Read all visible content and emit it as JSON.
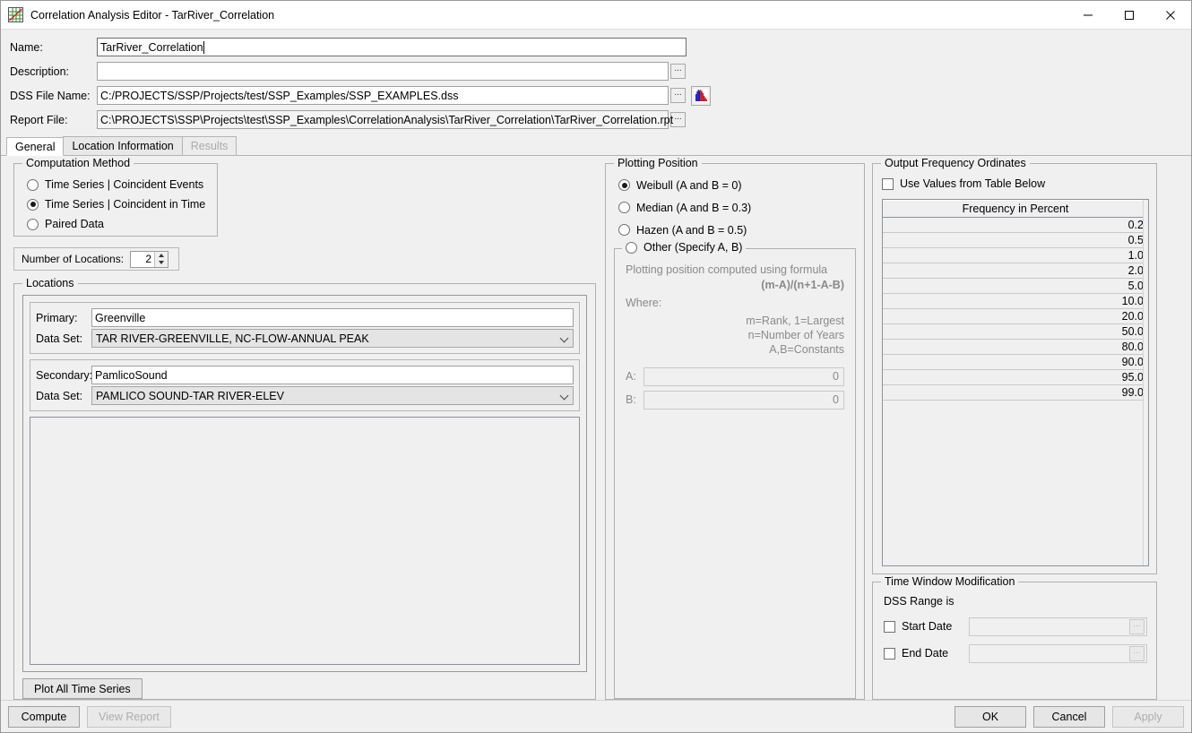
{
  "window": {
    "title": "Correlation Analysis Editor - TarRiver_Correlation",
    "app_icon": "correlation-plot-icon",
    "minimize_icon": "minimize-icon",
    "maximize_icon": "maximize-icon",
    "close_icon": "close-icon"
  },
  "form": {
    "name_label": "Name:",
    "name_value": "TarRiver_Correlation",
    "description_label": "Description:",
    "description_value": "",
    "dss_label": "DSS File Name:",
    "dss_value": "C:/PROJECTS/SSP/Projects/test/SSP_Examples/SSP_EXAMPLES.dss",
    "report_label": "Report File:",
    "report_value": "C:\\PROJECTS\\SSP\\Projects\\test\\SSP_Examples\\CorrelationAnalysis\\TarRiver_Correlation\\TarRiver_Correlation.rpt",
    "browse_label": "...",
    "dss_icon": "histogram-icon"
  },
  "tabs": [
    {
      "label": "General",
      "state": "active"
    },
    {
      "label": "Location Information",
      "state": "enabled"
    },
    {
      "label": "Results",
      "state": "disabled"
    }
  ],
  "computation_method": {
    "legend": "Computation Method",
    "options": [
      {
        "label": "Time Series | Coincident Events",
        "selected": false
      },
      {
        "label": "Time Series | Coincident in Time",
        "selected": true
      },
      {
        "label": "Paired Data",
        "selected": false
      }
    ]
  },
  "number_of_locations": {
    "label": "Number of Locations:",
    "value": "2"
  },
  "locations": {
    "legend": "Locations",
    "primary": {
      "label": "Primary:",
      "value": "Greenville",
      "dataset_label": "Data Set:",
      "dataset_value": "TAR RIVER-GREENVILLE, NC-FLOW-ANNUAL PEAK"
    },
    "secondary": {
      "label": "Secondary:",
      "value": "PamlicoSound",
      "dataset_label": "Data Set:",
      "dataset_value": "PAMLICO SOUND-TAR RIVER-ELEV"
    },
    "plot_button": "Plot All Time Series"
  },
  "plotting_position": {
    "legend": "Plotting Position",
    "options": [
      {
        "label": "Weibull (A and B = 0)",
        "selected": true
      },
      {
        "label": "Median (A and B = 0.3)",
        "selected": false
      },
      {
        "label": "Hazen (A and B = 0.5)",
        "selected": false
      }
    ],
    "other": {
      "label": "Other (Specify A, B)",
      "selected": false,
      "formula_intro": "Plotting position computed using formula",
      "formula": "(m-A)/(n+1-A-B)",
      "where_label": "Where:",
      "where_lines": [
        "m=Rank, 1=Largest",
        "n=Number of Years",
        "A,B=Constants"
      ],
      "a_label": "A:",
      "a_value": "0",
      "b_label": "B:",
      "b_value": "0"
    }
  },
  "output_frequency_ordinates": {
    "legend": "Output Frequency Ordinates",
    "use_values_label": "Use Values from Table Below",
    "use_values_checked": false,
    "column_header": "Frequency in Percent",
    "values": [
      "0.2",
      "0.5",
      "1.0",
      "2.0",
      "5.0",
      "10.0",
      "20.0",
      "50.0",
      "80.0",
      "90.0",
      "95.0",
      "99.0"
    ]
  },
  "time_window": {
    "legend": "Time Window Modification",
    "dss_range_label": "DSS Range is",
    "start_date_label": "Start Date",
    "start_date_checked": false,
    "start_date_value": "",
    "end_date_label": "End Date",
    "end_date_checked": false,
    "end_date_value": "",
    "browse_label": "..."
  },
  "footer": {
    "compute": "Compute",
    "view_report": "View Report",
    "view_report_enabled": false,
    "ok": "OK",
    "cancel": "Cancel",
    "apply": "Apply",
    "apply_enabled": false
  }
}
